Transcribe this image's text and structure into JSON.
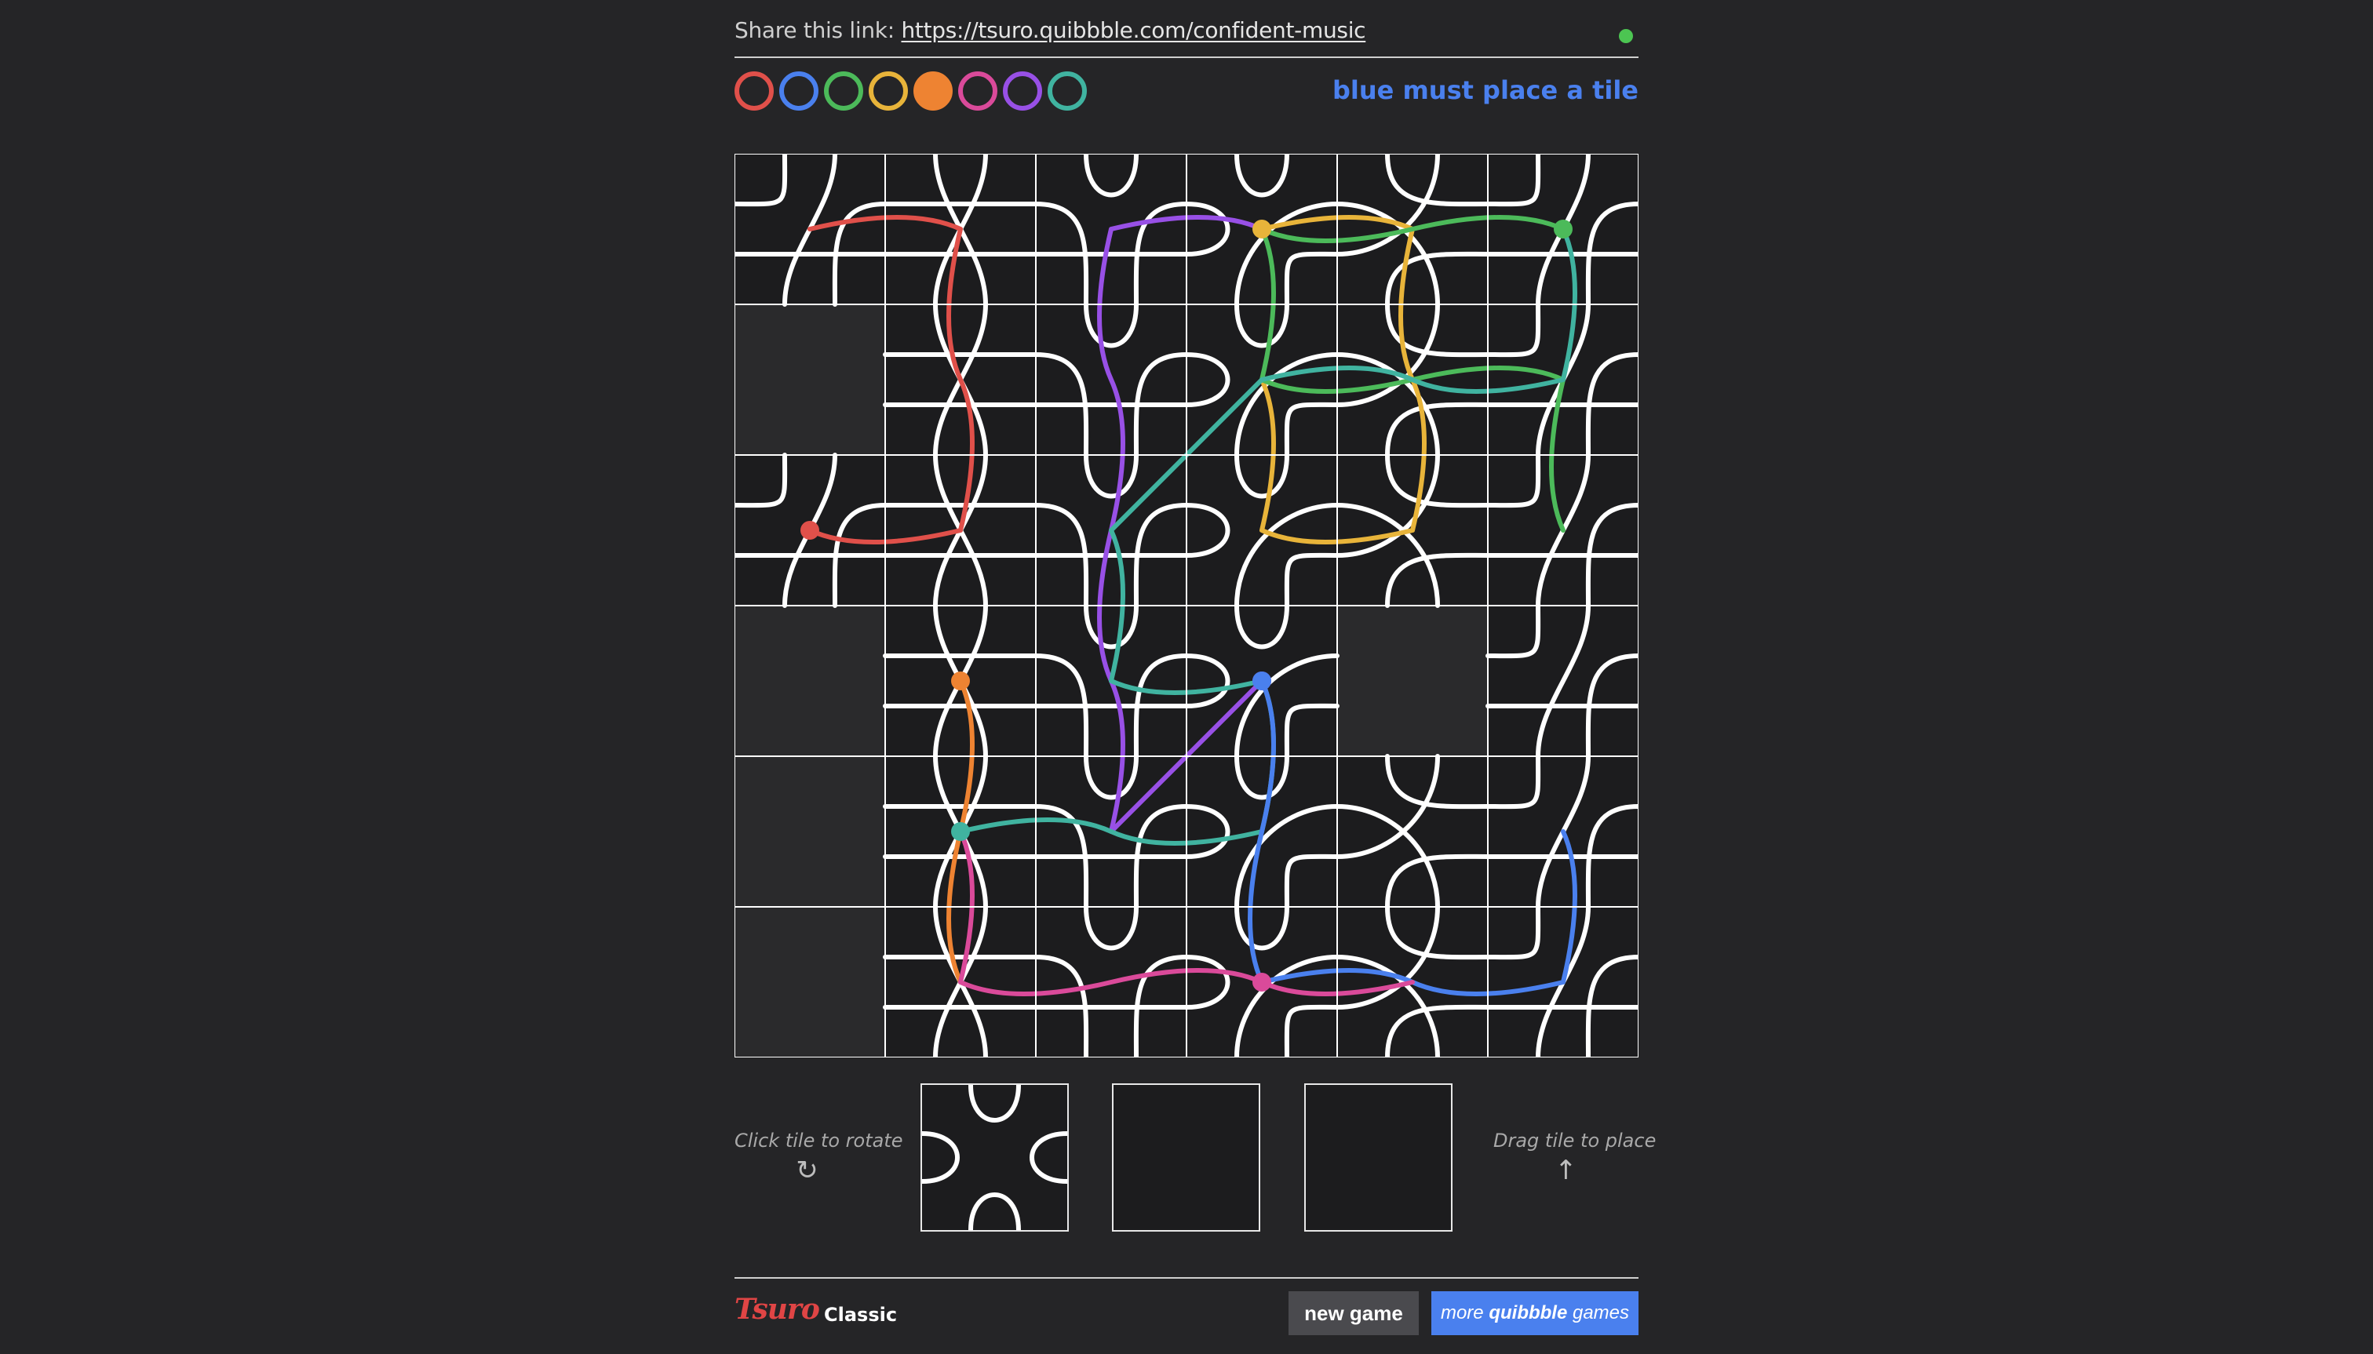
{
  "share": {
    "label": "Share this link:",
    "url": "https://tsuro.quibbble.com/confident-music"
  },
  "connection": {
    "status_color": "#4cc552"
  },
  "players": [
    {
      "color": "red",
      "hex": "#e0504a",
      "active": false
    },
    {
      "color": "blue",
      "hex": "#4a80ee",
      "active": false
    },
    {
      "color": "green",
      "hex": "#4cba5a",
      "active": false
    },
    {
      "color": "yellow",
      "hex": "#e8b43a",
      "active": false
    },
    {
      "color": "orange",
      "hex": "#ee8332",
      "active": true
    },
    {
      "color": "pink",
      "hex": "#da4a9a",
      "active": false
    },
    {
      "color": "purple",
      "hex": "#9850e6",
      "active": false
    },
    {
      "color": "teal",
      "hex": "#40b3a0",
      "active": false
    }
  ],
  "status": "blue must place a tile",
  "hints": {
    "rotate": "Click tile to rotate",
    "rotate_icon": "↻",
    "place": "Drag tile to place",
    "place_icon": "↑"
  },
  "footer": {
    "logo": "Tsuro",
    "edition": "Classic",
    "new_game": "new game",
    "more_pre": "more",
    "more_brand": "quibbble",
    "more_post": "games"
  },
  "colors": {
    "red": "#e0504a",
    "blue": "#4a80ee",
    "green": "#4cba5a",
    "yellow": "#e8b43a",
    "orange": "#ee8332",
    "pink": "#da4a9a",
    "purple": "#9850e6",
    "teal": "#40b3a0",
    "empty": "#2a2a2c"
  },
  "board": {
    "rows": 6,
    "cols": 6,
    "empty_cells": [
      [
        1,
        0
      ],
      [
        3,
        0
      ],
      [
        4,
        0
      ],
      [
        5,
        0
      ],
      [
        3,
        4
      ]
    ],
    "paths": [
      {
        "color": "red",
        "cells": [
          [
            0,
            0
          ],
          [
            0,
            1
          ],
          [
            1,
            1
          ],
          [
            2,
            1
          ],
          [
            2,
            0
          ]
        ],
        "endpoint": [
          2,
          0
        ]
      },
      {
        "color": "purple",
        "cells": [
          [
            0,
            3
          ],
          [
            0,
            2
          ],
          [
            1,
            2
          ],
          [
            2,
            2
          ],
          [
            3,
            2
          ],
          [
            4,
            2
          ],
          [
            3,
            3
          ]
        ],
        "endpoint": [
          3,
          3
        ]
      },
      {
        "color": "yellow",
        "cells": [
          [
            0,
            3
          ],
          [
            0,
            4
          ],
          [
            1,
            4
          ],
          [
            2,
            4
          ],
          [
            2,
            3
          ],
          [
            1,
            3
          ]
        ],
        "endpoint": [
          0,
          3
        ]
      },
      {
        "color": "green",
        "cells": [
          [
            0,
            5
          ],
          [
            0,
            4
          ],
          [
            0,
            3
          ],
          [
            1,
            3
          ],
          [
            1,
            4
          ],
          [
            1,
            5
          ],
          [
            2,
            5
          ]
        ],
        "endpoint": [
          0,
          5
        ]
      },
      {
        "color": "teal",
        "cells": [
          [
            0,
            5
          ],
          [
            1,
            5
          ],
          [
            1,
            4
          ],
          [
            1,
            3
          ],
          [
            2,
            2
          ],
          [
            3,
            2
          ],
          [
            3,
            3
          ],
          [
            4,
            3
          ],
          [
            4,
            2
          ],
          [
            4,
            1
          ]
        ],
        "endpoint": [
          4,
          1
        ]
      },
      {
        "color": "orange",
        "cells": [
          [
            3,
            1
          ],
          [
            4,
            1
          ],
          [
            5,
            1
          ]
        ],
        "endpoint": [
          3,
          1
        ]
      },
      {
        "color": "blue",
        "cells": [
          [
            3,
            3
          ],
          [
            4,
            3
          ],
          [
            5,
            3
          ],
          [
            5,
            4
          ],
          [
            5,
            5
          ],
          [
            4,
            5
          ]
        ],
        "endpoint": [
          3,
          3
        ]
      },
      {
        "color": "pink",
        "cells": [
          [
            4,
            1
          ],
          [
            5,
            1
          ],
          [
            5,
            2
          ],
          [
            5,
            3
          ],
          [
            5,
            4
          ]
        ],
        "endpoint": [
          5,
          3
        ]
      }
    ]
  },
  "hand": [
    {
      "slot": 1,
      "filled": true
    },
    {
      "slot": 2,
      "filled": false
    },
    {
      "slot": 3,
      "filled": false
    }
  ]
}
